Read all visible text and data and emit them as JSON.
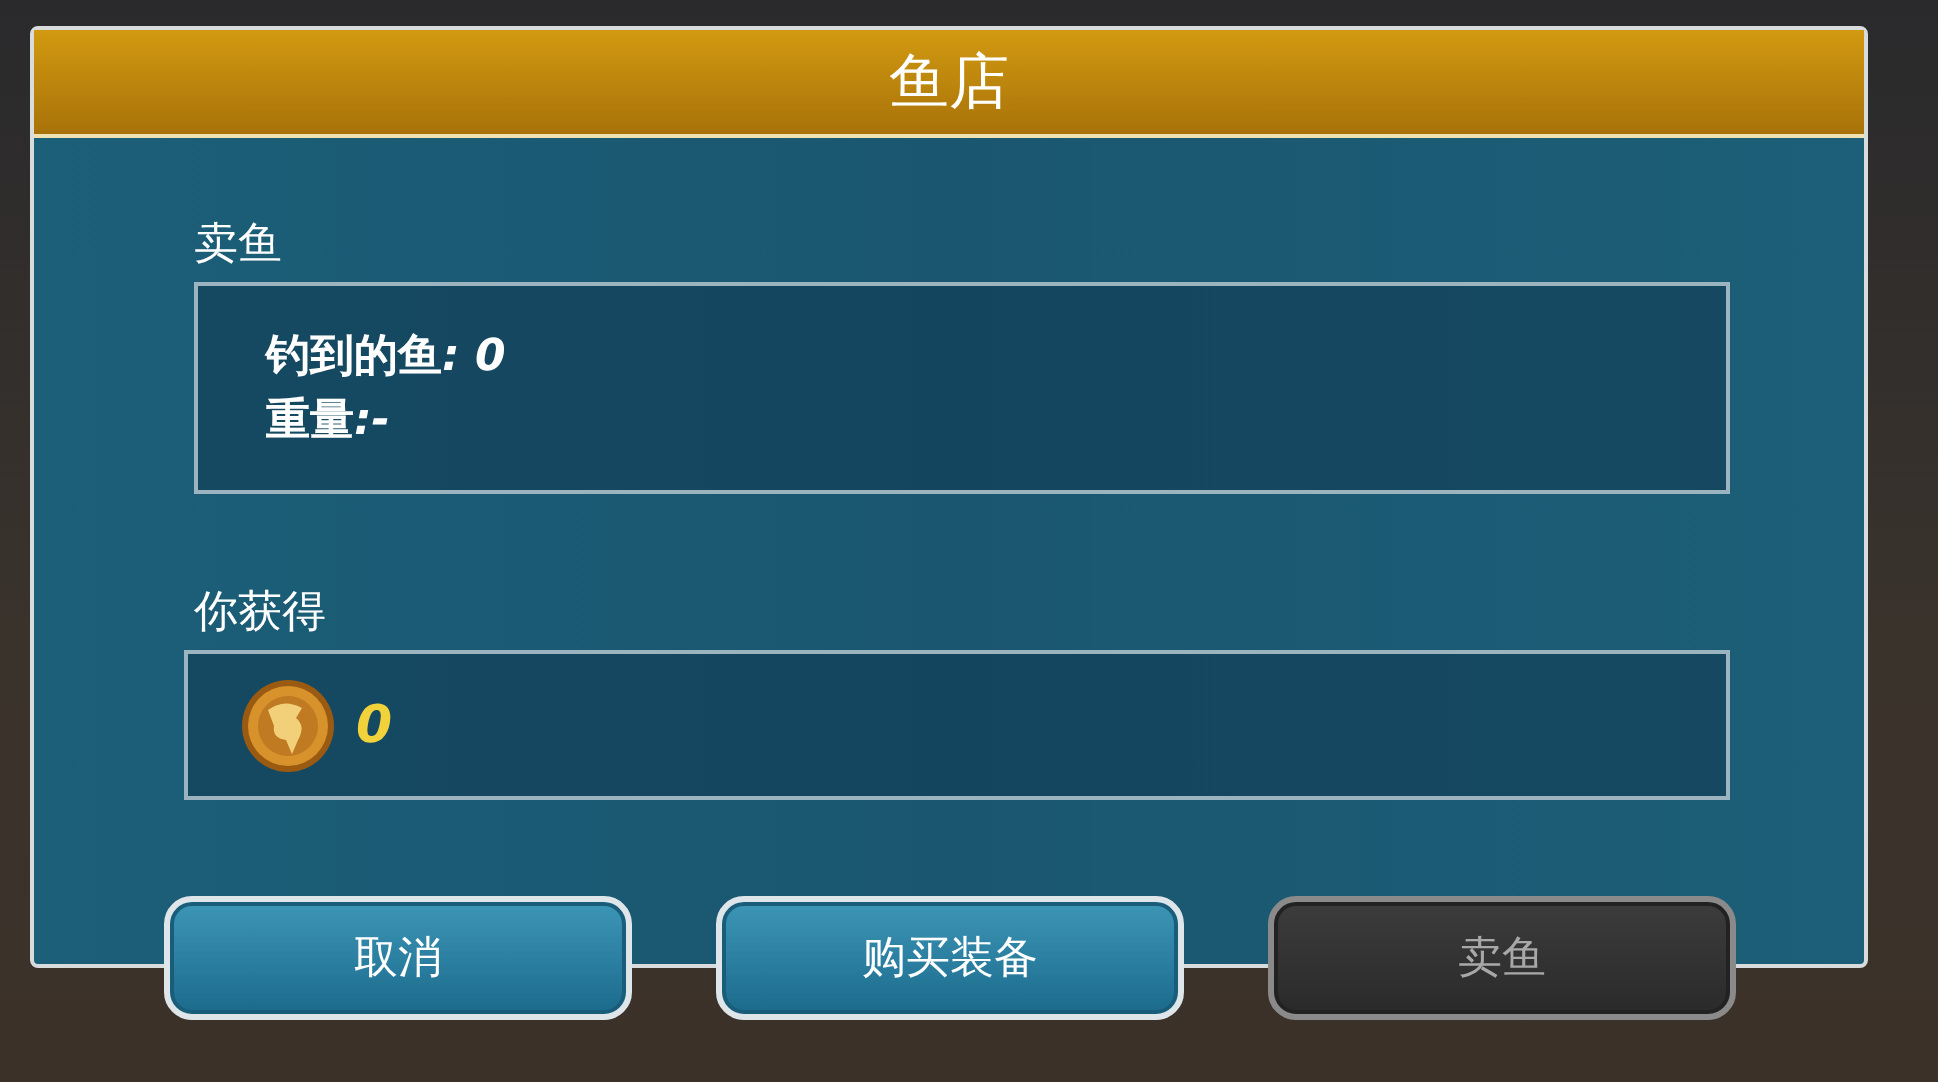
{
  "dialog": {
    "title": "鱼店"
  },
  "sell_section": {
    "label": "卖鱼",
    "lines": [
      {
        "label": "钓到的鱼",
        "value": ": 0"
      },
      {
        "label": "重量",
        "value": ":-"
      }
    ]
  },
  "earn_section": {
    "label": "你获得",
    "amount": "0"
  },
  "buttons": [
    {
      "label": "取消",
      "disabled": false
    },
    {
      "label": "购买装备",
      "disabled": false
    },
    {
      "label": "卖鱼",
      "disabled": true
    }
  ]
}
